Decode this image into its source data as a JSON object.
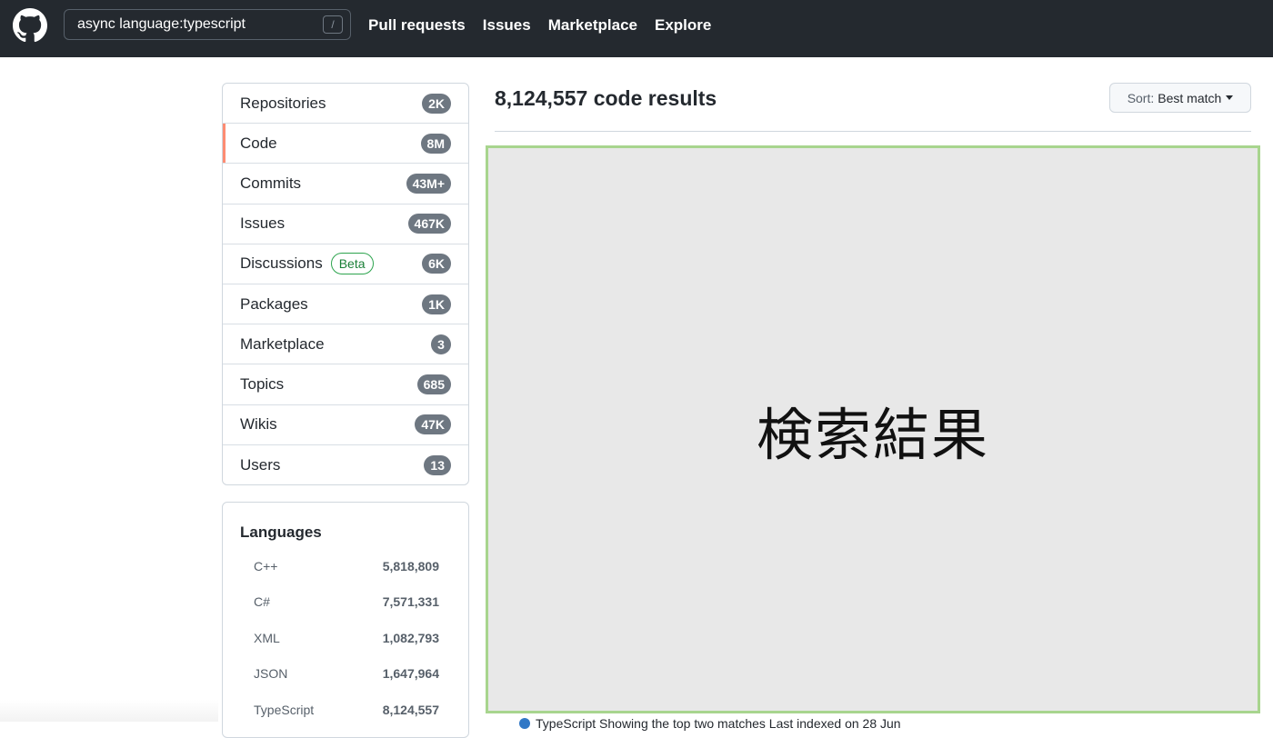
{
  "header": {
    "search_value": "async language:typescript",
    "search_shortcut": "/",
    "nav": [
      "Pull requests",
      "Issues",
      "Marketplace",
      "Explore"
    ]
  },
  "menu": {
    "items": [
      {
        "label": "Repositories",
        "count": "2K"
      },
      {
        "label": "Code",
        "count": "8M",
        "selected": true
      },
      {
        "label": "Commits",
        "count": "43M+"
      },
      {
        "label": "Issues",
        "count": "467K"
      },
      {
        "label": "Discussions",
        "badge": "Beta",
        "count": "6K"
      },
      {
        "label": "Packages",
        "count": "1K"
      },
      {
        "label": "Marketplace",
        "count": "3"
      },
      {
        "label": "Topics",
        "count": "685"
      },
      {
        "label": "Wikis",
        "count": "47K"
      },
      {
        "label": "Users",
        "count": "13"
      }
    ]
  },
  "languages": {
    "title": "Languages",
    "items": [
      {
        "name": "C++",
        "count": "5,818,809"
      },
      {
        "name": "C#",
        "count": "7,571,331"
      },
      {
        "name": "XML",
        "count": "1,082,793"
      },
      {
        "name": "JSON",
        "count": "1,647,964"
      },
      {
        "name": "TypeScript",
        "count": "8,124,557"
      }
    ]
  },
  "main": {
    "results_title": "8,124,557 code results",
    "sort_label": "Sort:",
    "sort_value": "Best match",
    "placeholder_text": "検索結果",
    "cut_text": "TypeScript  Showing the top two matches  Last indexed on 28 Jun"
  },
  "colors": {
    "header_bg": "#24292f",
    "selected_accent": "#fd8c73",
    "counter_bg": "#6e7781",
    "beta_green": "#1a7f37",
    "placeholder_border": "#a8d58e",
    "placeholder_bg": "#e8e8e8"
  }
}
